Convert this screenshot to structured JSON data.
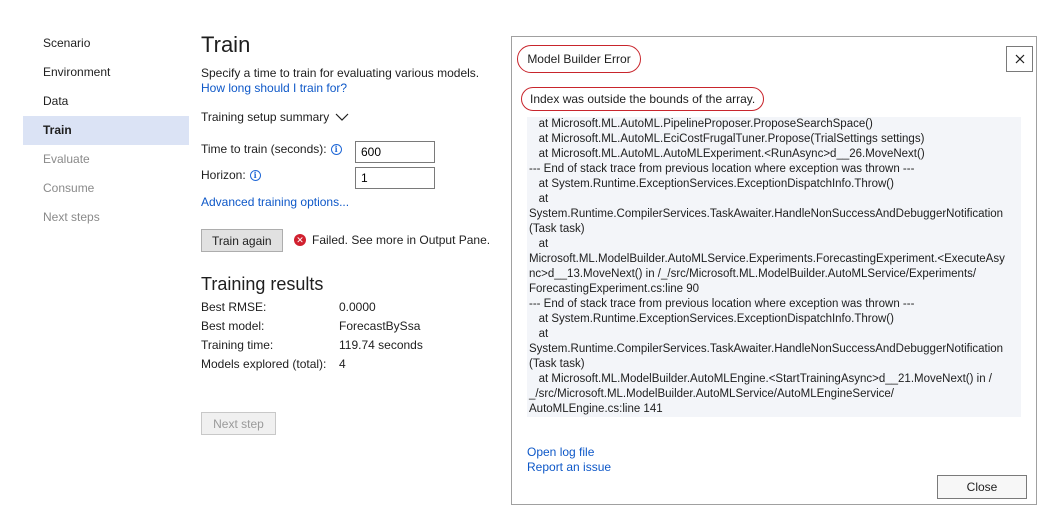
{
  "nav": {
    "items": [
      {
        "label": "Scenario",
        "state": "normal"
      },
      {
        "label": "Environment",
        "state": "normal"
      },
      {
        "label": "Data",
        "state": "normal"
      },
      {
        "label": "Train",
        "state": "selected"
      },
      {
        "label": "Evaluate",
        "state": "disabled"
      },
      {
        "label": "Consume",
        "state": "disabled"
      },
      {
        "label": "Next steps",
        "state": "disabled"
      }
    ]
  },
  "train": {
    "title": "Train",
    "subtitle": "Specify a time to train for evaluating various models.",
    "help_link": "How long should I train for?",
    "summary_label": "Training setup summary",
    "time_label": "Time to train (seconds):",
    "time_value": "600",
    "horizon_label": "Horizon:",
    "horizon_value": "1",
    "advanced_link": "Advanced training options...",
    "train_again_label": "Train again",
    "status_text": "Failed. See more in Output Pane.",
    "results_title": "Training results",
    "results": [
      {
        "key": "Best RMSE:",
        "value": "0.0000"
      },
      {
        "key": "Best model:",
        "value": "ForecastBySsa"
      },
      {
        "key": "Training time:",
        "value": "119.74 seconds"
      },
      {
        "key": "Models explored (total):",
        "value": "4"
      }
    ],
    "next_step_label": "Next step"
  },
  "dialog": {
    "title": "Model Builder Error",
    "message": "Index was outside the bounds of the array.",
    "stack": [
      "   at Microsoft.ML.AutoML.PipelineProposer.ProposeSearchSpace()",
      "   at Microsoft.ML.AutoML.EciCostFrugalTuner.Propose(TrialSettings settings)",
      "   at Microsoft.ML.AutoML.AutoMLExperiment.<RunAsync>d__26.MoveNext()",
      "--- End of stack trace from previous location where exception was thrown ---",
      "   at System.Runtime.ExceptionServices.ExceptionDispatchInfo.Throw()",
      "   at",
      "System.Runtime.CompilerServices.TaskAwaiter.HandleNonSuccessAndDebuggerNotification",
      "(Task task)",
      "   at",
      "Microsoft.ML.ModelBuilder.AutoMLService.Experiments.ForecastingExperiment.<ExecuteAsy",
      "nc>d__13.MoveNext() in /_/src/Microsoft.ML.ModelBuilder.AutoMLService/Experiments/",
      "ForecastingExperiment.cs:line 90",
      "--- End of stack trace from previous location where exception was thrown ---",
      "   at System.Runtime.ExceptionServices.ExceptionDispatchInfo.Throw()",
      "   at",
      "System.Runtime.CompilerServices.TaskAwaiter.HandleNonSuccessAndDebuggerNotification",
      "(Task task)",
      "   at Microsoft.ML.ModelBuilder.AutoMLEngine.<StartTrainingAsync>d__21.MoveNext() in /",
      "_/src/Microsoft.ML.ModelBuilder.AutoMLService/AutoMLEngineService/",
      "AutoMLEngine.cs:line 141"
    ],
    "open_log_label": "Open log file",
    "report_issue_label": "Report an issue",
    "close_label": "Close",
    "accent_color": "#c8252c"
  }
}
